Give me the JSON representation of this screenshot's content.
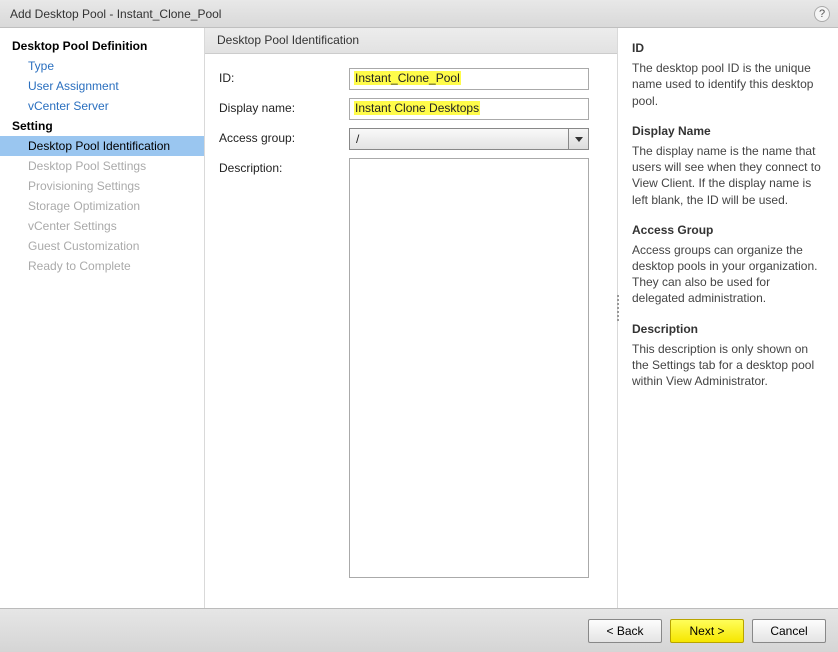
{
  "titlebar": {
    "title": "Add Desktop Pool - Instant_Clone_Pool",
    "help_tooltip": "?"
  },
  "sidebar": {
    "groups": [
      {
        "label": "Desktop Pool Definition",
        "items": [
          {
            "label": "Type",
            "state": "link"
          },
          {
            "label": "User Assignment",
            "state": "link"
          },
          {
            "label": "vCenter Server",
            "state": "link"
          }
        ]
      },
      {
        "label": "Setting",
        "items": [
          {
            "label": "Desktop Pool Identification",
            "state": "active"
          },
          {
            "label": "Desktop Pool Settings",
            "state": "disabled"
          },
          {
            "label": "Provisioning Settings",
            "state": "disabled"
          },
          {
            "label": "Storage Optimization",
            "state": "disabled"
          },
          {
            "label": "vCenter Settings",
            "state": "disabled"
          },
          {
            "label": "Guest Customization",
            "state": "disabled"
          },
          {
            "label": "Ready to Complete",
            "state": "disabled"
          }
        ]
      }
    ]
  },
  "main": {
    "section_header": "Desktop Pool Identification",
    "fields": {
      "id": {
        "label": "ID:",
        "value": "Instant_Clone_Pool"
      },
      "display_name": {
        "label": "Display name:",
        "value": "Instant Clone Desktops"
      },
      "access_group": {
        "label": "Access group:",
        "selected": "/"
      },
      "description": {
        "label": "Description:",
        "value": ""
      }
    }
  },
  "help": {
    "id": {
      "title": "ID",
      "text": "The desktop pool ID is the unique name used to identify this desktop pool."
    },
    "display_name": {
      "title": "Display Name",
      "text": "The display name is the name that users will see when they connect to View Client. If the display name is left blank, the ID will be used."
    },
    "access_group": {
      "title": "Access Group",
      "text": "Access groups can organize the desktop pools in your organization. They can also be used for delegated administration."
    },
    "description": {
      "title": "Description",
      "text": "This description is only shown on the Settings tab for a desktop pool within View Administrator."
    }
  },
  "footer": {
    "back": "< Back",
    "next": "Next >",
    "cancel": "Cancel"
  }
}
